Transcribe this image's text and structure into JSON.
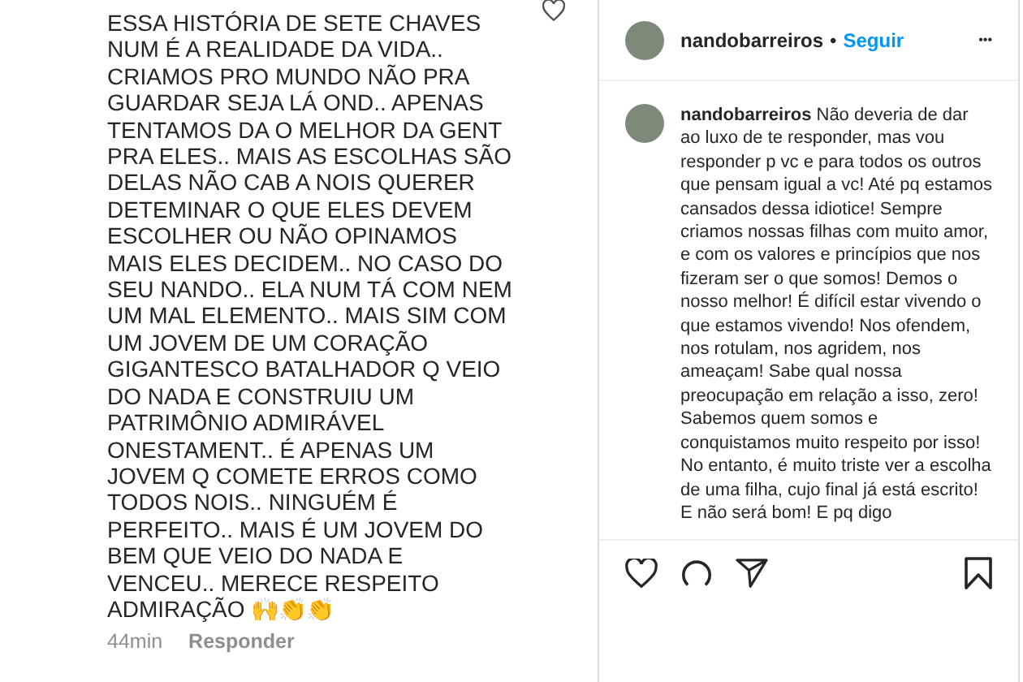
{
  "comment": {
    "text": "ESSA HISTÓRIA DE SETE CHAVES NUM É A REALIDADE DA VIDA.. CRIAMOS PRO MUNDO NÃO PRA GUARDAR SEJA LÁ OND.. APENAS TENTAMOS DA O MELHOR DA GENT PRA ELES.. MAIS AS ESCOLHAS SÃO DELAS NÃO CAB A NOIS QUERER DETEMINAR O QUE ELES DEVEM ESCOLHER OU NÃO OPINAMOS MAIS ELES DECIDEM.. NO CASO DO SEU NANDO.. ELA NUM TÁ COM NEM UM MAL ELEMENTO.. MAIS SIM COM UM JOVEM DE UM CORAÇÃO GIGANTESCO BATALHADOR Q VEIO DO NADA E CONSTRUIU UM PATRIMÔNIO ADMIRÁVEL ONESTAMENT.. É  APENAS UM JOVEM Q COMETE ERROS COMO TODOS NOIS.. NINGUÉM É PERFEITO.. MAIS É UM JOVEM DO BEM QUE VEIO DO NADA E VENCEU.. MERECE RESPEITO ADMIRAÇÃO 🙌👏👏",
    "time": "44min",
    "reply": "Responder"
  },
  "post": {
    "header": {
      "username": "nandobarreiros",
      "separator": "•",
      "follow": "Seguir",
      "more": "•••"
    },
    "caption": {
      "username": "nandobarreiros",
      "text": "Não deveria de dar ao luxo de te responder, mas vou responder p vc e para todos os outros que pensam igual a vc! Até pq estamos cansados dessa idiotice! Sempre criamos nossas filhas com muito amor, e com os valores e princípios que nos fizeram ser o que somos! Demos o nosso melhor! É difícil estar vivendo o que estamos vivendo! Nos ofendem, nos rotulam, nos agridem, nos ameaçam! Sabe qual nossa preocupação em relação a isso, zero! Sabemos quem somos e conquistamos muito respeito por isso! No entanto, é muito triste ver a escolha de uma filha, cujo final já está escrito! E não será bom! E pq digo"
    }
  }
}
